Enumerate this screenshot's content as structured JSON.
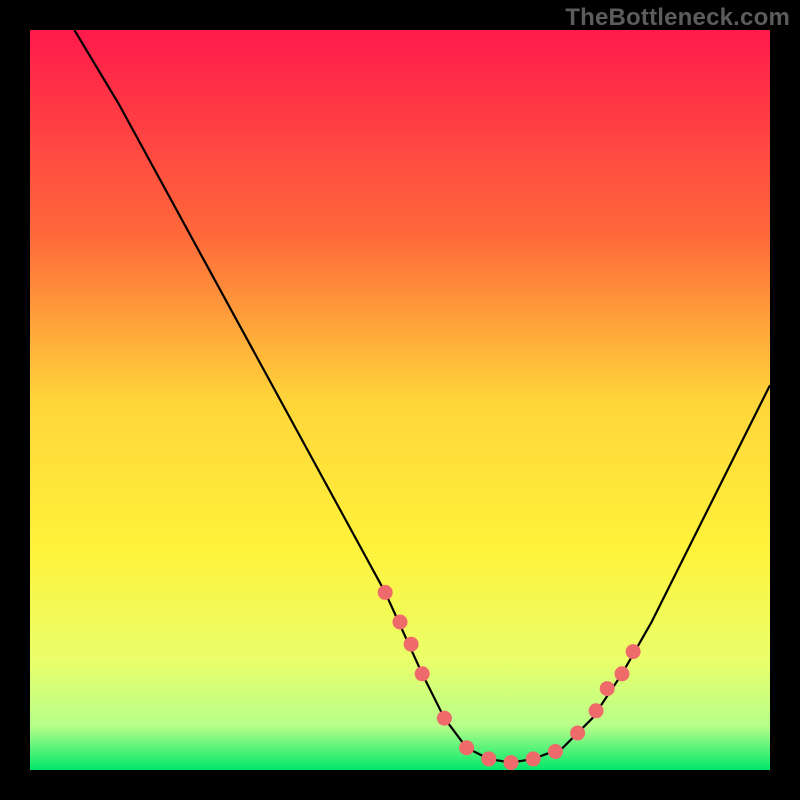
{
  "watermark": "TheBottleneck.com",
  "chart_data": {
    "type": "line",
    "title": "",
    "xlabel": "",
    "ylabel": "",
    "xlim": [
      0,
      100
    ],
    "ylim": [
      0,
      100
    ],
    "grid": false,
    "gradient_stops": [
      {
        "offset": 0.0,
        "color": "#ff1a4b"
      },
      {
        "offset": 0.28,
        "color": "#ff6a3a"
      },
      {
        "offset": 0.5,
        "color": "#ffd53a"
      },
      {
        "offset": 0.7,
        "color": "#fff23a"
      },
      {
        "offset": 0.85,
        "color": "#eaff6a"
      },
      {
        "offset": 0.94,
        "color": "#b8ff8a"
      },
      {
        "offset": 1.0,
        "color": "#00e86a"
      }
    ],
    "series": [
      {
        "name": "curve",
        "type": "line",
        "color": "#000000",
        "x": [
          6,
          12,
          18,
          24,
          30,
          36,
          42,
          48,
          53,
          56,
          59,
          62,
          65,
          68,
          72,
          76,
          80,
          84,
          88,
          92,
          96,
          100
        ],
        "y": [
          100,
          90,
          79,
          68,
          57,
          46,
          35,
          24,
          13,
          7,
          3,
          1.5,
          1,
          1.5,
          3,
          7,
          13,
          20,
          28,
          36,
          44,
          52
        ]
      },
      {
        "name": "dots",
        "type": "scatter",
        "color": "#ef6a6a",
        "x": [
          48,
          50,
          51.5,
          53,
          56,
          59,
          62,
          65,
          68,
          71,
          74,
          76.5,
          78,
          80,
          81.5
        ],
        "y": [
          24,
          20,
          17,
          13,
          7,
          3,
          1.5,
          1,
          1.5,
          2.5,
          5,
          8,
          11,
          13,
          16
        ]
      }
    ]
  }
}
